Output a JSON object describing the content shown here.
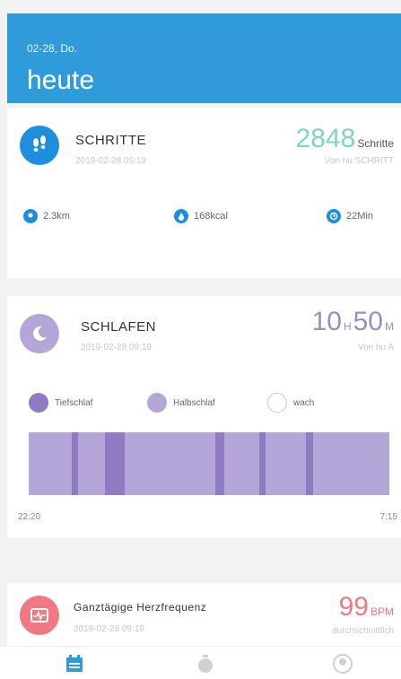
{
  "header": {
    "date": "02-28, Do.",
    "title": "heute"
  },
  "steps": {
    "title": "SCHRITTE",
    "timestamp": "2019-02-28 09:19",
    "value": "2848",
    "unit": "Schritte",
    "note": "Von hu SCHRITT",
    "stats": {
      "distance": "2.3km",
      "calories": "168kcal",
      "duration": "22Min"
    },
    "color": "#1e8fdc",
    "value_color": "#7dd3c4"
  },
  "sleep": {
    "title": "SCHLAFEN",
    "timestamp": "2019-02-28 09:19",
    "hours": "10",
    "h_unit": "H",
    "minutes": "50",
    "m_unit": "M",
    "note": "Von hu A",
    "legend": {
      "deep": "Tiefschlaf",
      "light": "Halbschlaf",
      "awake": "wach"
    },
    "start_time": "22:20",
    "end_time": "7:15",
    "color": "#b4a6d6",
    "deep_color": "#8f7bc2"
  },
  "heart": {
    "title": "Ganztägige Herzfrequenz",
    "timestamp": "2019-02-28 09:19",
    "value": "99",
    "unit": "BPM",
    "note": "durchschnittlich",
    "color": "#ef7a84"
  },
  "tabs": [
    {
      "name": "today",
      "icon": "calendar-icon",
      "active": true
    },
    {
      "name": "timer",
      "icon": "stopwatch-icon",
      "active": false
    },
    {
      "name": "profile",
      "icon": "user-icon",
      "active": false
    }
  ],
  "colors": {
    "accent": "#2f9bd8",
    "tab_active": "#2f9bd8",
    "tab_inactive": "#d0d0d0"
  }
}
